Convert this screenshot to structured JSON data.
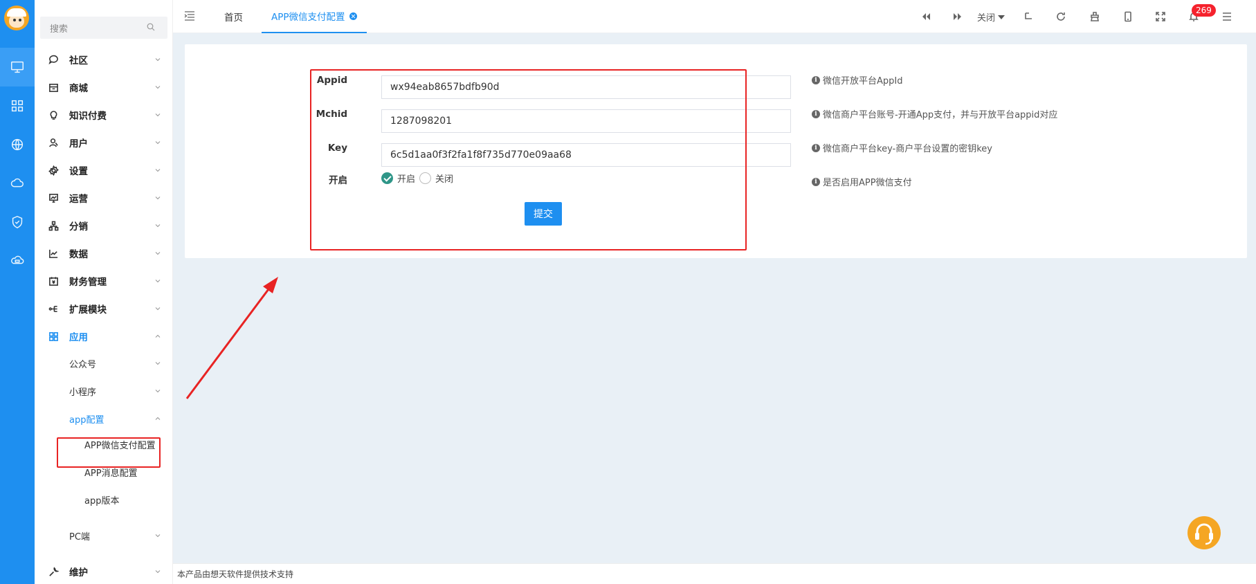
{
  "sidebar": {
    "search_placeholder": "搜索",
    "menu": [
      {
        "label": "社区",
        "icon": "chat-icon"
      },
      {
        "label": "商城",
        "icon": "store-icon"
      },
      {
        "label": "知识付费",
        "icon": "lightbulb-icon"
      },
      {
        "label": "用户",
        "icon": "user-icon"
      },
      {
        "label": "设置",
        "icon": "gear-icon"
      },
      {
        "label": "运营",
        "icon": "monitor-chart-icon"
      },
      {
        "label": "分销",
        "icon": "hierarchy-icon"
      },
      {
        "label": "数据",
        "icon": "line-chart-icon"
      },
      {
        "label": "财务管理",
        "icon": "finance-icon"
      },
      {
        "label": "扩展模块",
        "icon": "extension-icon"
      },
      {
        "label": "应用",
        "icon": "apps-icon"
      }
    ],
    "app_children": [
      {
        "label": "公众号"
      },
      {
        "label": "小程序"
      },
      {
        "label": "app配置"
      }
    ],
    "app_config_children": [
      {
        "label": "APP微信支付配置"
      },
      {
        "label": "APP消息配置"
      },
      {
        "label": "app版本"
      }
    ],
    "pc_label": "PC端",
    "maintain_label": "维护"
  },
  "topbar": {
    "tabs": [
      {
        "label": "首页"
      },
      {
        "label": "APP微信支付配置"
      }
    ],
    "close_label": "关闭",
    "notification_count": "269"
  },
  "form": {
    "fields": [
      {
        "label": "Appid",
        "value": "wx94eab8657bdfb90d",
        "hint": "微信开放平台AppId"
      },
      {
        "label": "Mchid",
        "value": "1287098201",
        "hint": "微信商户平台账号-开通App支付，并与开放平台appid对应"
      },
      {
        "label": "Key",
        "value": "6c5d1aa0f3f2fa1f8f735d770e09aa68",
        "hint": "微信商户平台key-商户平台设置的密钥key"
      }
    ],
    "enable_label": "开启",
    "radio_on": "开启",
    "radio_off": "关闭",
    "enabled": true,
    "enable_hint": "是否启用APP微信支付",
    "submit_label": "提交"
  },
  "footer": {
    "text": "本产品由想天软件提供技术支持"
  },
  "colors": {
    "primary": "#1e8ff0",
    "annotation": "#e82323",
    "radio_checked": "#2f9688"
  }
}
